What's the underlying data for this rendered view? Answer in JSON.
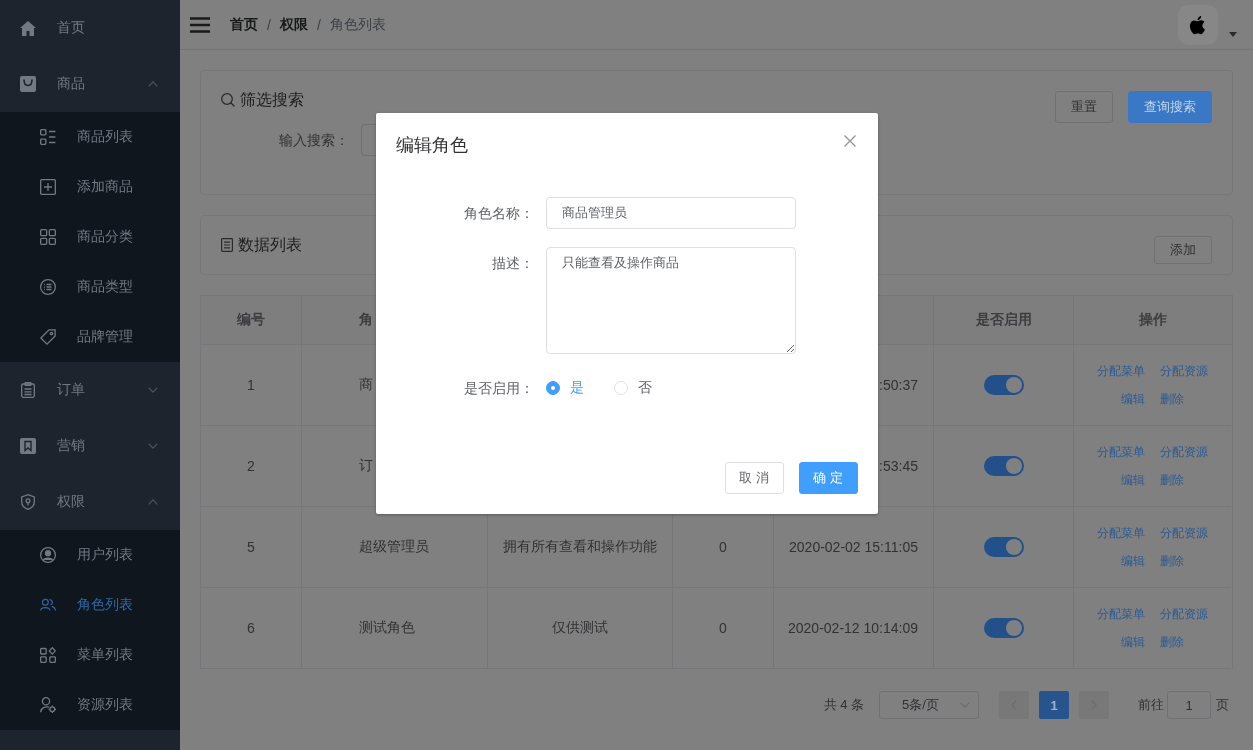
{
  "sidebar": {
    "items": [
      {
        "kind": "link",
        "label": "首页",
        "selected": false
      },
      {
        "kind": "submenu",
        "label": "商品",
        "expanded": true,
        "children": [
          {
            "label": "商品列表",
            "selected": false
          },
          {
            "label": "添加商品",
            "selected": false
          },
          {
            "label": "商品分类",
            "selected": false
          },
          {
            "label": "商品类型",
            "selected": false
          },
          {
            "label": "品牌管理",
            "selected": false
          }
        ]
      },
      {
        "kind": "submenu",
        "label": "订单",
        "expanded": false
      },
      {
        "kind": "submenu",
        "label": "营销",
        "expanded": false
      },
      {
        "kind": "submenu",
        "label": "权限",
        "expanded": true,
        "children": [
          {
            "label": "用户列表",
            "selected": false
          },
          {
            "label": "角色列表",
            "selected": true
          },
          {
            "label": "菜单列表",
            "selected": false
          },
          {
            "label": "资源列表",
            "selected": false
          }
        ]
      }
    ]
  },
  "header": {
    "breadcrumb": [
      {
        "label": "首页",
        "current": false
      },
      {
        "separator": "/",
        "label": "权限",
        "current": false
      },
      {
        "separator": "/",
        "label": "角色列表",
        "current": true
      }
    ]
  },
  "filter": {
    "title": "筛选搜索",
    "search_label": "输入搜索：",
    "buttons": [
      {
        "kind": "default",
        "label": "重置"
      },
      {
        "kind": "primary",
        "label": "查询搜索"
      }
    ]
  },
  "data_list": {
    "title": "数据列表",
    "add_button": "添加"
  },
  "table": {
    "columns": {
      "number": "编号",
      "column_2": "角",
      "enabled": "是否启用",
      "actions": "操作"
    },
    "rows": [
      {
        "number": "1",
        "column_2": "商",
        "column_5": ":50:37",
        "enabled": true,
        "actions": [
          "分配菜单",
          "分配资源",
          "编辑",
          "删除"
        ]
      },
      {
        "number": "2",
        "column_2": "订",
        "column_5": ":53:45",
        "enabled": true,
        "actions": [
          "分配菜单",
          "分配资源",
          "编辑",
          "删除"
        ]
      },
      {
        "number": "5",
        "column_2": "超级管理员",
        "column_3": "拥有所有查看和操作功能",
        "column_4": "0",
        "column_5": "2020-02-02 15:11:05",
        "enabled": true,
        "actions": [
          "分配菜单",
          "分配资源",
          "编辑",
          "删除"
        ]
      },
      {
        "number": "6",
        "column_2": "测试角色",
        "column_3": "仅供测试",
        "column_4": "0",
        "column_5": "2020-02-12 10:14:09",
        "enabled": true,
        "actions": [
          "分配菜单",
          "分配资源",
          "编辑",
          "删除"
        ]
      }
    ]
  },
  "pagination": {
    "total": "共 4 条",
    "page_size": "5条/页",
    "prev": {
      "disabled": true
    },
    "pages": [
      {
        "label": "1",
        "selected": true
      }
    ],
    "next": {
      "disabled": true
    },
    "goto_label": "前往",
    "goto_value": "1",
    "goto_suffix": "页"
  },
  "dialog": {
    "title": "编辑角色",
    "fields": [
      {
        "kind": "input",
        "label": "角色名称：",
        "value": "商品管理员"
      },
      {
        "kind": "textarea",
        "label": "描述：",
        "value": "只能查看及操作商品"
      },
      {
        "kind": "radio",
        "label": "是否启用：",
        "options": [
          {
            "label": "是",
            "selected": true
          },
          {
            "label": "否",
            "selected": false
          }
        ]
      }
    ],
    "buttons": [
      {
        "kind": "default",
        "label": "取 消"
      },
      {
        "kind": "primary",
        "label": "确 定"
      }
    ]
  }
}
